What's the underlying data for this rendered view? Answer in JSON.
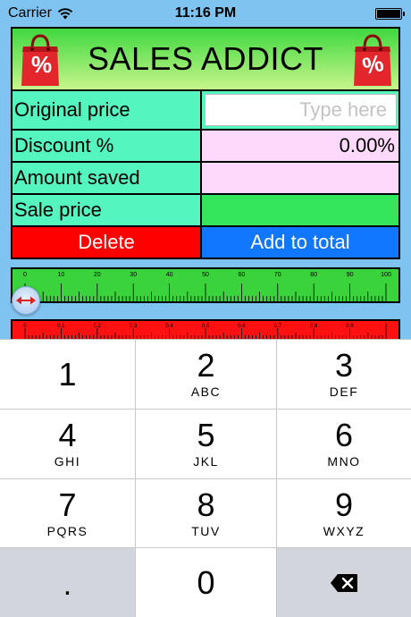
{
  "status_bar": {
    "carrier": "Carrier",
    "time": "11:16 PM"
  },
  "header": {
    "title": "SALES ADDICT",
    "bag_left_symbol": "%",
    "bag_right_symbol": "%"
  },
  "form": {
    "original_price_label": "Original price",
    "original_price_placeholder": "Type here",
    "discount_label": "Discount %",
    "discount_value": "0.00%",
    "amount_saved_label": "Amount saved",
    "amount_saved_value": "",
    "sale_price_label": "Sale price",
    "sale_price_value": ""
  },
  "actions": {
    "delete_label": "Delete",
    "add_label": "Add to total"
  },
  "rulers": {
    "green_ticks": [
      "0",
      "10",
      "20",
      "30",
      "40",
      "50",
      "60",
      "70",
      "80",
      "90",
      "100"
    ],
    "red_ticks": [
      "0",
      "0.1",
      "0.2",
      "0.3",
      "0.4",
      "0.5",
      "0.6",
      "0.7",
      "0.8",
      "0.9",
      "1"
    ]
  },
  "slider": {
    "value": 0
  },
  "keypad": {
    "keys": [
      {
        "num": "1",
        "letters": ""
      },
      {
        "num": "2",
        "letters": "ABC"
      },
      {
        "num": "3",
        "letters": "DEF"
      },
      {
        "num": "4",
        "letters": "GHI"
      },
      {
        "num": "5",
        "letters": "JKL"
      },
      {
        "num": "6",
        "letters": "MNO"
      },
      {
        "num": "7",
        "letters": "PQRS"
      },
      {
        "num": "8",
        "letters": "TUV"
      },
      {
        "num": "9",
        "letters": "WXYZ"
      },
      {
        "num": ".",
        "letters": ""
      },
      {
        "num": "0",
        "letters": ""
      }
    ]
  },
  "colors": {
    "header_top": "#3fd83f",
    "label_bg": "#55f5bf",
    "delete": "#ff0000",
    "add": "#1177ff",
    "sale_price": "#33e65c",
    "pink": "#ffd9fb"
  }
}
